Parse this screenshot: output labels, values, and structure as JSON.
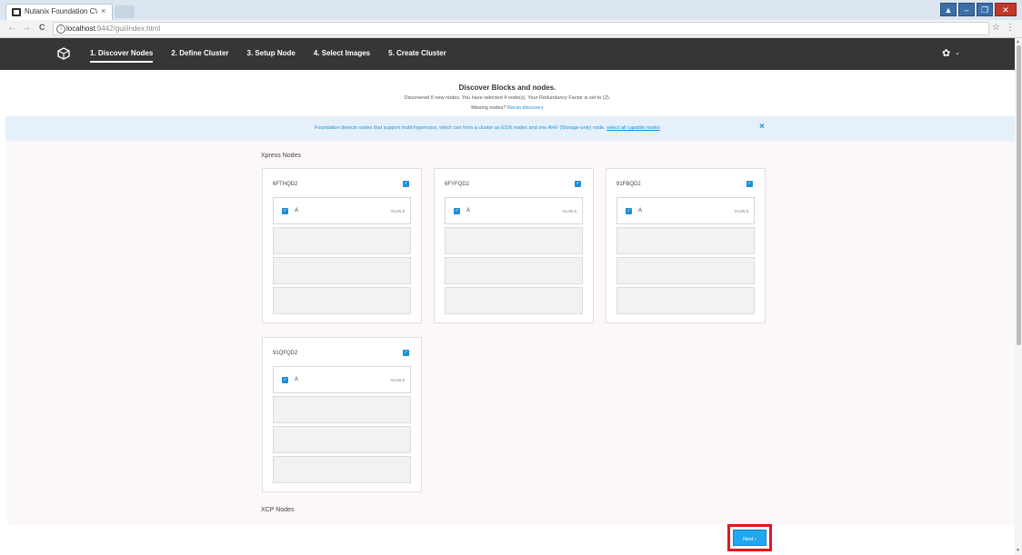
{
  "browser": {
    "tab_title": "Nutanix Foundation CVM",
    "tab_close": "×",
    "url_host": "localhost",
    "url_path": ":9442/gui/index.html",
    "window_buttons": [
      "▲",
      "–",
      "❐",
      "✕"
    ]
  },
  "nav": {
    "back": "←",
    "forward": "→",
    "reload": "C",
    "info": "i",
    "star": "☆",
    "menu": "⋮"
  },
  "app": {
    "steps": [
      {
        "label": "1. Discover Nodes",
        "active": true
      },
      {
        "label": "2. Define Cluster",
        "active": false
      },
      {
        "label": "3. Setup Node",
        "active": false
      },
      {
        "label": "4. Select Images",
        "active": false
      },
      {
        "label": "5. Create Cluster",
        "active": false
      }
    ],
    "gear": "✿",
    "gear_caret": "⌄"
  },
  "header": {
    "title": "Discover Blocks and nodes.",
    "subtitle": "Discovered 8 new nodes. You have selected 4 node(s). Your Redundancy Factor is set to (2).",
    "missing_text": "Missing nodes?",
    "rerun_link": "Rerun discovery"
  },
  "banner": {
    "message": "Foundation detects nodes that support multi-hypervisor, which can form a cluster as ESXi nodes and one AHV (Storage-only) node.",
    "link": "select all capable nodes",
    "close": "×"
  },
  "sections": {
    "xpress": "Xpress Nodes",
    "xcp": "XCP Nodes"
  },
  "blocks": [
    {
      "serial": "6FTHQD2",
      "node": "A",
      "vlan": "VLAN 0"
    },
    {
      "serial": "6FYFQD2",
      "node": "A",
      "vlan": "VLAN 0"
    },
    {
      "serial": "91FBQD2",
      "node": "A",
      "vlan": "VLAN 0"
    },
    {
      "serial": "91QFQD2",
      "node": "A",
      "vlan": "VLAN 0"
    }
  ],
  "footer": {
    "next_label": "Next ›"
  },
  "colors": {
    "accent": "#1d8fd8",
    "nav_bg": "#363636",
    "highlight": "#e8141a"
  }
}
